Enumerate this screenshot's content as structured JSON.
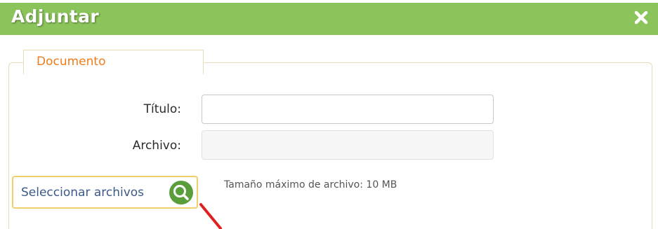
{
  "dialog": {
    "title": "Adjuntar",
    "close_icon": "close-icon",
    "colors": {
      "header": "#8bc45a",
      "legend": "#f07d1b",
      "button_border": "#f0d06a",
      "search_icon": "#5a9e3c"
    }
  },
  "section": {
    "legend": "Documento"
  },
  "form": {
    "title_label": "Título:",
    "title_value": "",
    "file_label": "Archivo:",
    "file_value": ""
  },
  "file_picker": {
    "button_label": "Seleccionar archivos",
    "icon": "search-icon",
    "hint": "Tamaño máximo de archivo: 10 MB"
  }
}
